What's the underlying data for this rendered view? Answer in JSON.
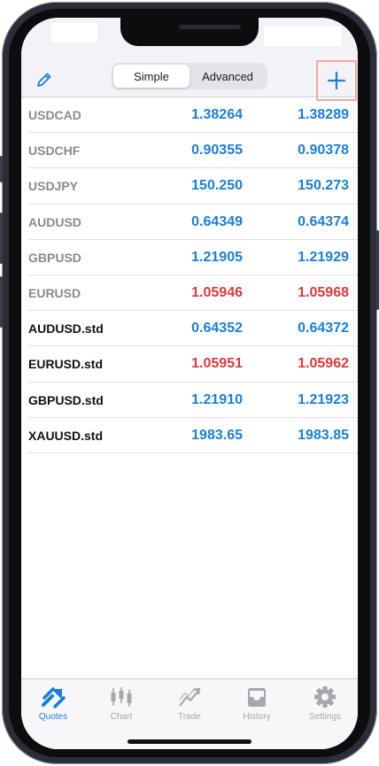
{
  "toolbar": {
    "edit_icon": "pencil-icon",
    "segments": [
      {
        "label": "Simple",
        "active": true
      },
      {
        "label": "Advanced",
        "active": false
      }
    ],
    "add_icon": "plus-icon"
  },
  "quotes": [
    {
      "symbol": "USDCAD",
      "bid": "1.38264",
      "ask": "1.38289",
      "direction": "up",
      "style": "dim"
    },
    {
      "symbol": "USDCHF",
      "bid": "0.90355",
      "ask": "0.90378",
      "direction": "up",
      "style": "dim"
    },
    {
      "symbol": "USDJPY",
      "bid": "150.250",
      "ask": "150.273",
      "direction": "up",
      "style": "dim"
    },
    {
      "symbol": "AUDUSD",
      "bid": "0.64349",
      "ask": "0.64374",
      "direction": "up",
      "style": "dim"
    },
    {
      "symbol": "GBPUSD",
      "bid": "1.21905",
      "ask": "1.21929",
      "direction": "up",
      "style": "dim"
    },
    {
      "symbol": "EURUSD",
      "bid": "1.05946",
      "ask": "1.05968",
      "direction": "down",
      "style": "dim"
    },
    {
      "symbol": "AUDUSD.std",
      "bid": "0.64352",
      "ask": "0.64372",
      "direction": "up",
      "style": "dark"
    },
    {
      "symbol": "EURUSD.std",
      "bid": "1.05951",
      "ask": "1.05962",
      "direction": "down",
      "style": "dark"
    },
    {
      "symbol": "GBPUSD.std",
      "bid": "1.21910",
      "ask": "1.21923",
      "direction": "up",
      "style": "dark"
    },
    {
      "symbol": "XAUUSD.std",
      "bid": "1983.65",
      "ask": "1983.85",
      "direction": "up",
      "style": "dark"
    }
  ],
  "tabs": [
    {
      "label": "Quotes",
      "icon": "quotes-icon",
      "active": true
    },
    {
      "label": "Chart",
      "icon": "chart-icon",
      "active": false
    },
    {
      "label": "Trade",
      "icon": "trade-icon",
      "active": false
    },
    {
      "label": "History",
      "icon": "history-icon",
      "active": false
    },
    {
      "label": "Settings",
      "icon": "settings-icon",
      "active": false
    }
  ],
  "colors": {
    "up": "#1b7fd4",
    "down": "#d83b3b",
    "accent": "#1b7fd4",
    "add_highlight": "#f0a8a0"
  }
}
